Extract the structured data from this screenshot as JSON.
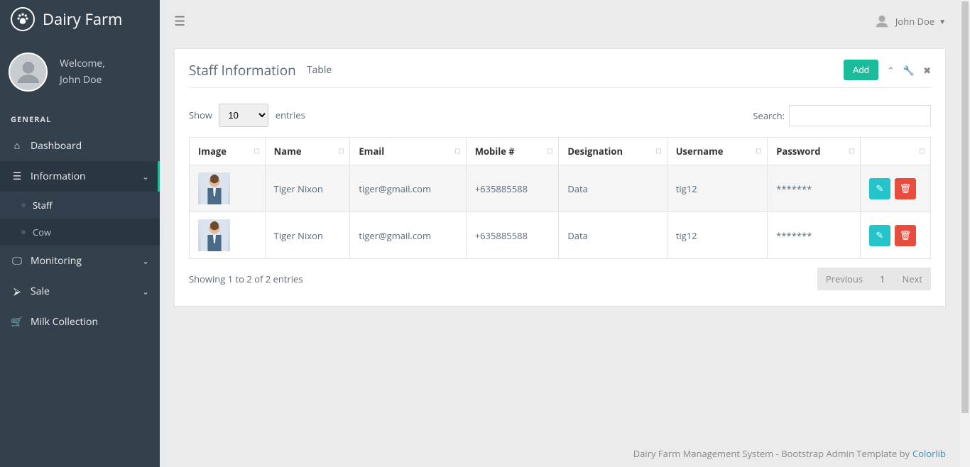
{
  "brand": {
    "title": "Dairy Farm"
  },
  "user": {
    "welcome": "Welcome,",
    "name": "John Doe"
  },
  "topbar": {
    "username": "John Doe"
  },
  "sidebar": {
    "section": "GENERAL",
    "items": {
      "dashboard": "Dashboard",
      "information": "Information",
      "monitoring": "Monitoring",
      "sale": "Sale",
      "milk": "Milk Collection"
    },
    "sub": {
      "staff": "Staff",
      "cow": "Cow"
    }
  },
  "panel": {
    "title": "Staff Information",
    "subtitle": "Table",
    "add": "Add"
  },
  "table": {
    "show_label": "Show",
    "entries_label": "entries",
    "entries_value": "10",
    "search_label": "Search:",
    "headers": {
      "image": "Image",
      "name": "Name",
      "email": "Email",
      "mobile": "Mobile #",
      "designation": "Designation",
      "username": "Username",
      "password": "Password"
    },
    "rows": [
      {
        "name": "Tiger Nixon",
        "email": "tiger@gmail.com",
        "mobile": "+635885588",
        "designation": "Data",
        "username": "tig12",
        "password": "*******"
      },
      {
        "name": "Tiger Nixon",
        "email": "tiger@gmail.com",
        "mobile": "+635885588",
        "designation": "Data",
        "username": "tig12",
        "password": "*******"
      }
    ],
    "info": "Showing 1 to 2 of 2 entries",
    "pager": {
      "prev": "Previous",
      "page": "1",
      "next": "Next"
    }
  },
  "footer": {
    "text": "Dairy Farm Management System - Bootstrap Admin Template by ",
    "link": "Colorlib"
  }
}
